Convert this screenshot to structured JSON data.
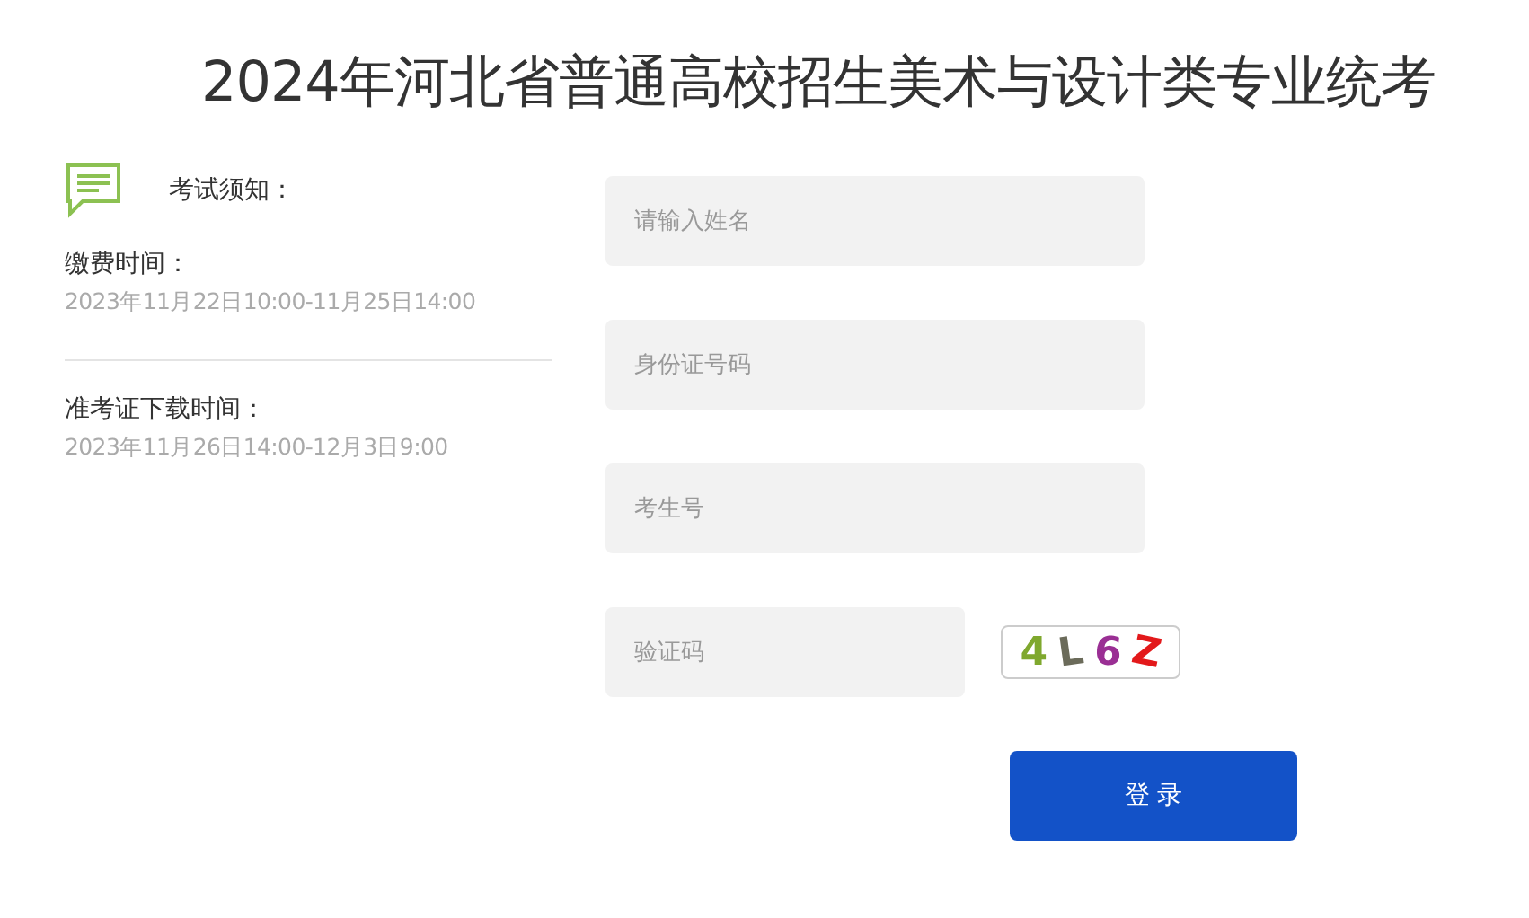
{
  "title": "2024年河北省普通高校招生美术与设计类专业统考",
  "notice": {
    "heading": "考试须知：",
    "items": [
      {
        "label": "缴费时间：",
        "value": "2023年11月22日10:00-11月25日14:00"
      },
      {
        "label": "准考证下载时间：",
        "value": "2023年11月26日14:00-12月3日9:00"
      }
    ]
  },
  "fields": [
    {
      "placeholder": "请输入姓名"
    },
    {
      "placeholder": "身份证号码"
    },
    {
      "placeholder": "考生号"
    }
  ],
  "captcha": {
    "placeholder": "验证码",
    "code": "4L6Z"
  },
  "login_button": "登 录"
}
